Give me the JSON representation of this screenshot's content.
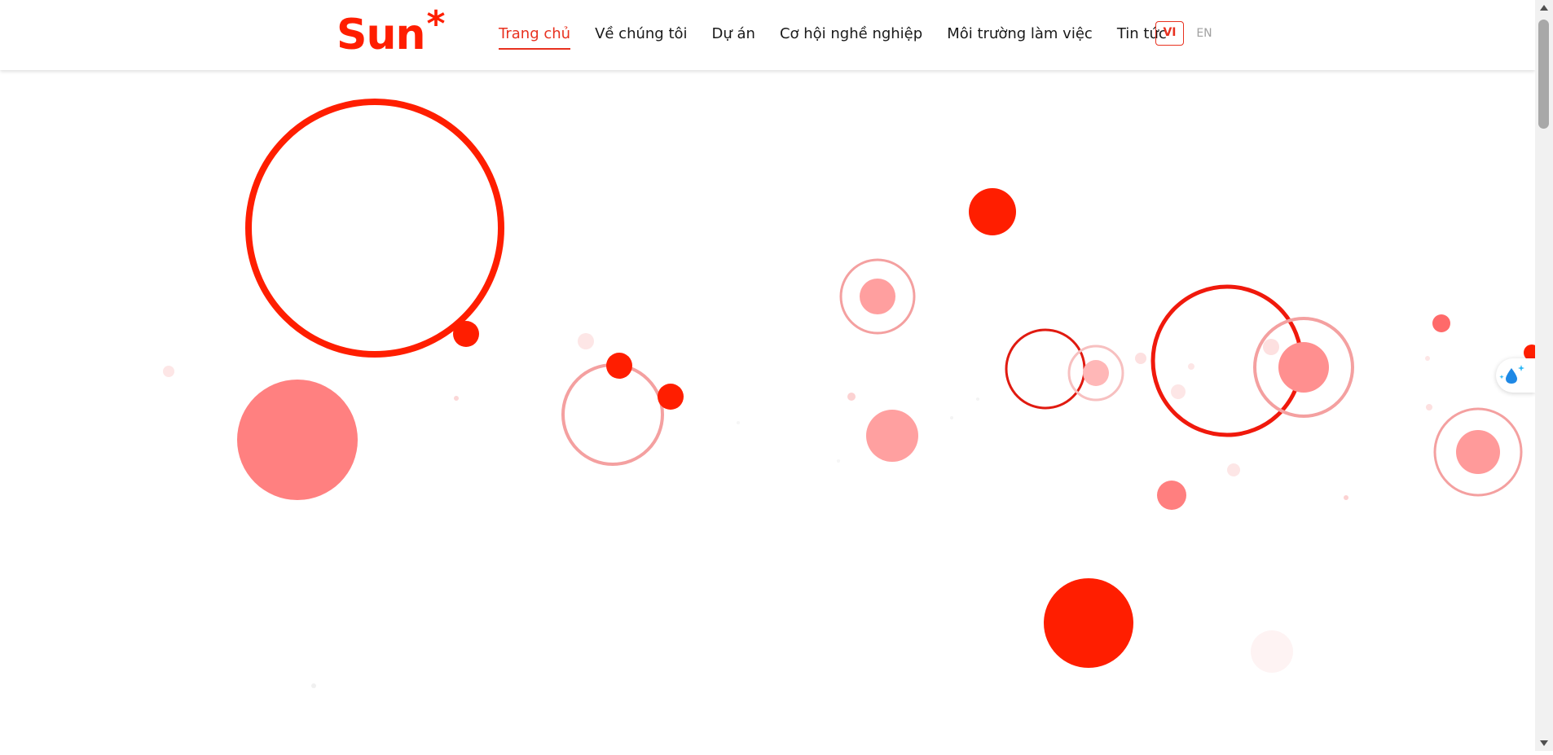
{
  "brand": {
    "name": "Sun",
    "mark": "*",
    "color": "#ff1e00"
  },
  "nav": {
    "items": [
      {
        "label": "Trang chủ",
        "active": true
      },
      {
        "label": "Về chúng tôi",
        "active": false
      },
      {
        "label": "Dự án",
        "active": false
      },
      {
        "label": "Cơ hội nghề nghiệp",
        "active": false
      },
      {
        "label": "Môi trường làm việc",
        "active": false
      },
      {
        "label": "Tin tức",
        "active": false
      }
    ],
    "active_color": "#e8311f"
  },
  "language": {
    "selected": "VI",
    "other": "EN"
  },
  "hero": {
    "decoration": "animated red bubbles",
    "colors": {
      "strong": "#ff1e00",
      "medium": "#ff7f7f",
      "light": "#ffb3b3"
    }
  },
  "widget": {
    "icon": "water-drop-sparkle-icon"
  }
}
